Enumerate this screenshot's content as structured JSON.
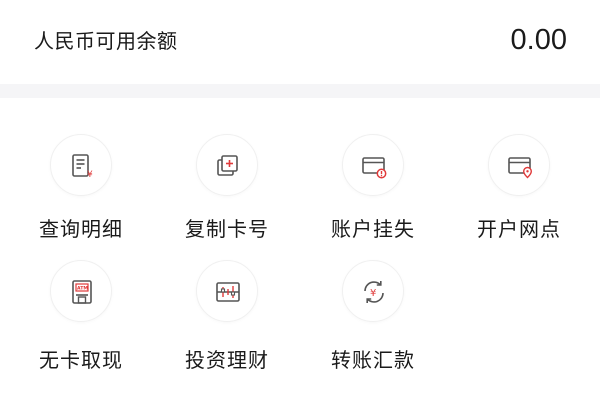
{
  "balance": {
    "label": "人民币可用余额",
    "value": "0.00"
  },
  "actions": [
    {
      "label": "查询明细",
      "icon": "statement-yuan-icon"
    },
    {
      "label": "复制卡号",
      "icon": "copy-card-icon"
    },
    {
      "label": "账户挂失",
      "icon": "card-report-loss-icon"
    },
    {
      "label": "开户网点",
      "icon": "card-location-icon"
    },
    {
      "label": "无卡取现",
      "icon": "atm-icon"
    },
    {
      "label": "投资理财",
      "icon": "investment-chart-icon"
    },
    {
      "label": "转账汇款",
      "icon": "transfer-yuan-icon"
    }
  ],
  "colors": {
    "accent": "#e03a3a",
    "icon_stroke": "#555555",
    "text": "#1a1a1a",
    "band": "#f5f5f7"
  }
}
